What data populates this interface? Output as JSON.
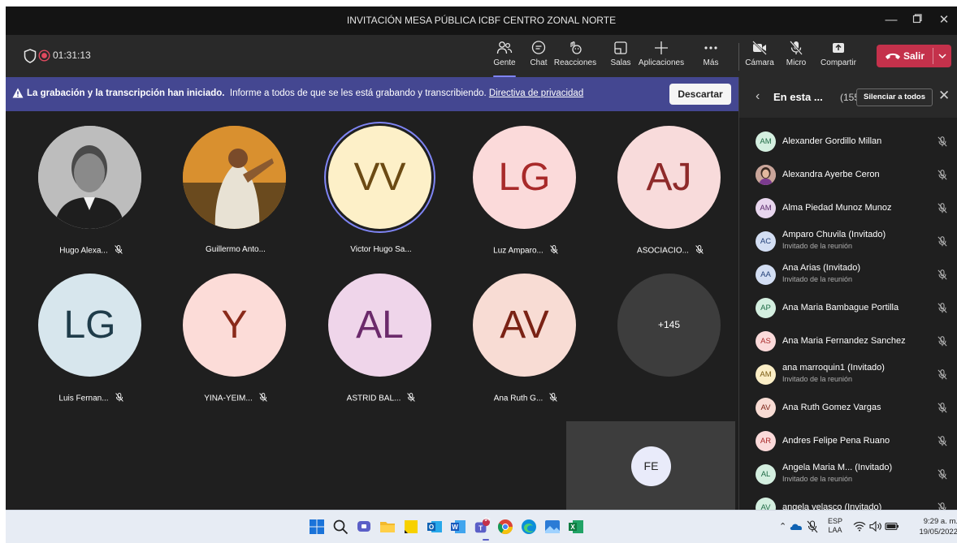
{
  "window": {
    "title": "INVITACIÓN MESA PÚBLICA ICBF CENTRO ZONAL NORTE"
  },
  "toolbar": {
    "timer": "01:31:13",
    "buttons": [
      {
        "label": "Gente",
        "icon": "people-icon"
      },
      {
        "label": "Chat",
        "icon": "chat-icon"
      },
      {
        "label": "Reacciones",
        "icon": "reactions-icon"
      },
      {
        "label": "Salas",
        "icon": "rooms-icon"
      },
      {
        "label": "Aplicaciones",
        "icon": "add-icon"
      },
      {
        "label": "Más",
        "icon": "more-icon"
      },
      {
        "label": "Cámara",
        "icon": "camera-off-icon"
      },
      {
        "label": "Micro",
        "icon": "mic-off-icon"
      },
      {
        "label": "Compartir",
        "icon": "share-icon"
      }
    ],
    "leave_label": "Salir"
  },
  "banner": {
    "bold": "La grabación y la transcripción han iniciado.",
    "text": "Informe a todos de que se les está grabando y transcribiendo.",
    "link": "Directiva de privacidad",
    "dismiss": "Descartar"
  },
  "gallery": {
    "tiles": [
      {
        "name": "Hugo Alexa...",
        "initials": "",
        "photo": true,
        "bg": "#cccccc",
        "fg": "#333333",
        "muted": true
      },
      {
        "name": "Guillermo Anto...",
        "initials": "",
        "photo": true,
        "bg": "#c7812a",
        "fg": "#333333",
        "muted": false
      },
      {
        "name": "Victor Hugo Sa...",
        "initials": "VV",
        "photo": false,
        "bg": "#fdf0c8",
        "fg": "#6b4a14",
        "muted": false
      },
      {
        "name": "Luz Amparo...",
        "initials": "LG",
        "photo": false,
        "bg": "#fbdada",
        "fg": "#a82a2a",
        "muted": true
      },
      {
        "name": "ASOCIACIO...",
        "initials": "AJ",
        "photo": false,
        "bg": "#f8dbdb",
        "fg": "#8e2a2a",
        "muted": true
      },
      {
        "name": "Luis Fernan...",
        "initials": "LG",
        "photo": false,
        "bg": "#d7e6ed",
        "fg": "#1f3c4a",
        "muted": true
      },
      {
        "name": "YINA-YEIM...",
        "initials": "Y",
        "photo": false,
        "bg": "#fcdcd8",
        "fg": "#8a2a1a",
        "muted": true
      },
      {
        "name": "ASTRID BAL...",
        "initials": "AL",
        "photo": false,
        "bg": "#efd5ea",
        "fg": "#6b2a6b",
        "muted": true
      },
      {
        "name": "Ana Ruth G...",
        "initials": "AV",
        "photo": false,
        "bg": "#f8dcd4",
        "fg": "#7a2215",
        "muted": true
      }
    ],
    "overflow": "+145",
    "self_initials": "FE"
  },
  "panel": {
    "title": "En esta ...",
    "count": "(155)",
    "mute_all": "Silenciar a todos",
    "participants": [
      {
        "initials": "AM",
        "name": "Alexander Gordillo Millan",
        "sub": "",
        "bg": "#d4efe0",
        "fg": "#1f6b45",
        "photo": false
      },
      {
        "initials": "",
        "name": "Alexandra Ayerbe Ceron",
        "sub": "",
        "bg": "#c9a59a",
        "fg": "#333333",
        "photo": true
      },
      {
        "initials": "AM",
        "name": "Alma Piedad Munoz Munoz",
        "sub": "",
        "bg": "#e8d6ee",
        "fg": "#5a2a6b",
        "photo": false
      },
      {
        "initials": "AC",
        "name": "Amparo Chuvila (Invitado)",
        "sub": "Invitado de la reunión",
        "bg": "#d3def3",
        "fg": "#213f77",
        "photo": false
      },
      {
        "initials": "AA",
        "name": "Ana Arias (Invitado)",
        "sub": "Invitado de la reunión",
        "bg": "#d3def3",
        "fg": "#213f77",
        "photo": false
      },
      {
        "initials": "AP",
        "name": "Ana Maria Bambague Portilla",
        "sub": "",
        "bg": "#d4efe0",
        "fg": "#1f6b45",
        "photo": false
      },
      {
        "initials": "AS",
        "name": "Ana Maria Fernandez Sanchez",
        "sub": "",
        "bg": "#fbdada",
        "fg": "#a82a2a",
        "photo": false
      },
      {
        "initials": "AM",
        "name": "ana marroquin1 (Invitado)",
        "sub": "Invitado de la reunión",
        "bg": "#fbeec6",
        "fg": "#7a5a10",
        "photo": false
      },
      {
        "initials": "AV",
        "name": "Ana Ruth Gomez Vargas",
        "sub": "",
        "bg": "#f8dcd4",
        "fg": "#7a2215",
        "photo": false
      },
      {
        "initials": "AR",
        "name": "Andres Felipe Pena Ruano",
        "sub": "",
        "bg": "#fbdada",
        "fg": "#a82a2a",
        "photo": false
      },
      {
        "initials": "AL",
        "name": "Angela Maria M... (Invitado)",
        "sub": "Invitado de la reunión",
        "bg": "#d4efe0",
        "fg": "#1f6b45",
        "photo": false
      },
      {
        "initials": "AV",
        "name": "angela velasco (Invitado)",
        "sub": "",
        "bg": "#d4efe0",
        "fg": "#1f6b45",
        "photo": false
      }
    ]
  },
  "taskbar": {
    "lang": "ESP",
    "region": "LAA",
    "time": "9:29 a. m.",
    "date": "19/05/2022",
    "teams_badge": "9+"
  },
  "colors": {
    "accent": "#7f85f5",
    "leave": "#c4314b",
    "banner": "#444791"
  }
}
